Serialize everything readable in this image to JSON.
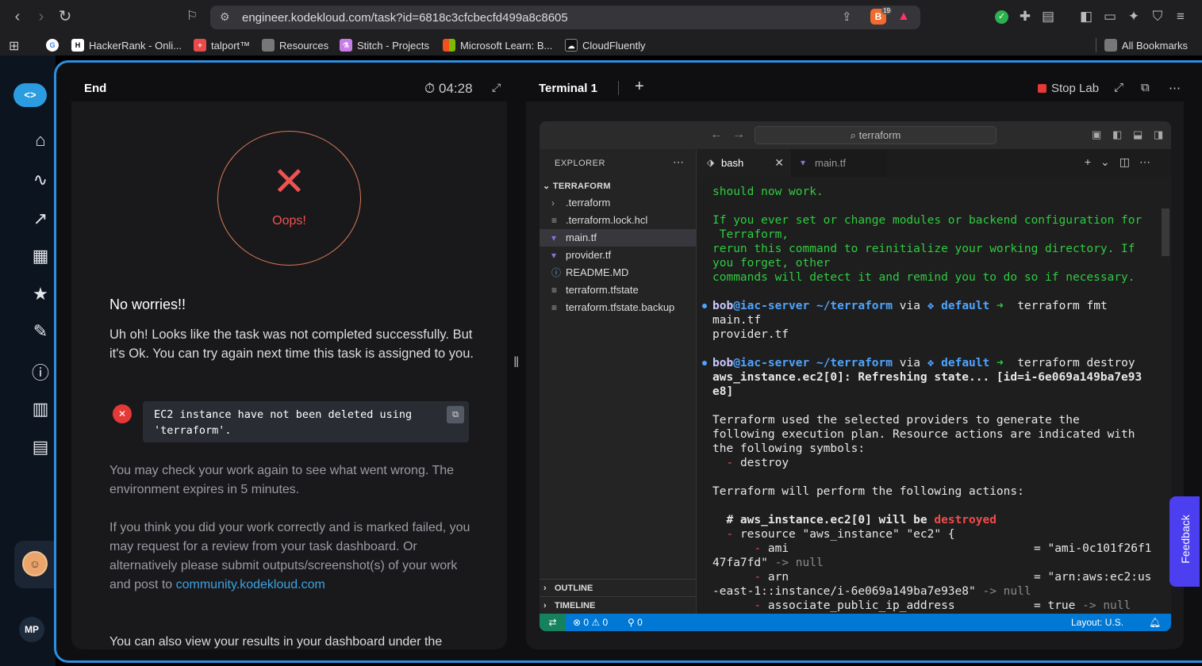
{
  "browser": {
    "url": "engineer.kodekloud.com/task?id=6818c3cfcbecfd499a8c8605",
    "brave_badge": "19",
    "bookmarks": [
      "HackerRank - Onli...",
      "talport™",
      "Resources",
      "Stitch - Projects",
      "Microsoft Learn: B...",
      "CloudFluently"
    ],
    "all_bookmarks": "All Bookmarks"
  },
  "sidebar": {
    "icons": [
      "home-icon",
      "route-icon",
      "chart-icon",
      "film-icon",
      "ranking-icon",
      "task-edit-icon",
      "info-icon",
      "book-icon",
      "chat-icon"
    ],
    "user_initials": "MP"
  },
  "left_panel": {
    "tab": "End",
    "timer": "04:28",
    "status_text": "Oops!",
    "heading": "No worries!!",
    "message": "Uh oh! Looks like the task was not completed successfully. But it's Ok. You can try again next time this task is assigned to you.",
    "error_line1": "EC2 instance have not been deleted using",
    "error_line2": "'terraform'.",
    "check_text": "You may check your work again to see what went wrong. The environment expires in 5 minutes.",
    "review_text": "If you think you did your work correctly and is marked failed, you may request for a review from your task dashboard. Or alternatively please submit outputs/screenshot(s) of your work and post to",
    "review_link": "community.kodekloud.com",
    "results_text": "You can also view your results in your dashboard under the"
  },
  "right_panel": {
    "tab": "Terminal 1",
    "stop_lab": "Stop Lab"
  },
  "vscode": {
    "search": "terraform",
    "explorer_title": "EXPLORER",
    "folder": "TERRAFORM",
    "files": [
      ".terraform",
      ".terraform.lock.hcl",
      "main.tf",
      "provider.tf",
      "README.MD",
      "terraform.tfstate",
      "terraform.tfstate.backup"
    ],
    "outline": "OUTLINE",
    "timeline": "TIMELINE",
    "tabs": [
      "bash",
      "main.tf"
    ],
    "status": {
      "errors": "0",
      "warnings": "0",
      "ports": "0",
      "layout": "Layout: U.S."
    }
  },
  "terminal": {
    "l1": "should now work.",
    "l2": "If you ever set or change modules or backend configuration for",
    "l3": " Terraform,",
    "l4": "rerun this command to reinitialize your working directory. If",
    "l5": "you forget, other",
    "l6": "commands will detect it and remind you to do so if necessary.",
    "user": "bob",
    "host": "@iac-server",
    "path": "~/terraform",
    "via": "via",
    "workspace": "default",
    "cmd1": "terraform fmt",
    "out1": "main.tf",
    "out2": "provider.tf",
    "cmd2": "terraform destroy",
    "refresh1": "aws_instance.ec2[0]: Refreshing state... [id=i-6e069a149ba7e93",
    "refresh2": "e8]",
    "plan1": "Terraform used the selected providers to generate the",
    "plan2": "following execution plan. Resource actions are indicated with",
    "plan3": "the following symbols:",
    "destroy_sym": "destroy",
    "perform": "Terraform will perform the following actions:",
    "res_comment": "# aws_instance.ec2[0] will be",
    "destroyed": "destroyed",
    "resource": "resource \"aws_instance\" \"ec2\" {",
    "ami_key": "ami",
    "ami_val1": "= \"ami-0c101f26f1",
    "ami_val2": "47fa7fd\"",
    "arn_key": "arn",
    "arn_val1": "= \"arn:aws:ec2:us",
    "arn_val2": "-east-1::instance/i-6e069a149ba7e93e8\"",
    "assoc_key": "associate_public_ip_address",
    "assoc_val": "= true",
    "null": "null"
  },
  "feedback": "Feedback"
}
